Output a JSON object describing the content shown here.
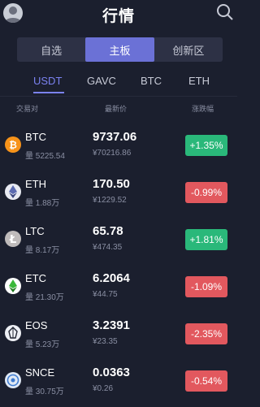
{
  "header": {
    "title": "行情"
  },
  "segments": [
    {
      "label": "自选"
    },
    {
      "label": "主板"
    },
    {
      "label": "创新区"
    }
  ],
  "market_tabs": [
    {
      "label": "USDT"
    },
    {
      "label": "GAVC"
    },
    {
      "label": "BTC"
    },
    {
      "label": "ETH"
    }
  ],
  "columns": {
    "pair": "交易对",
    "price": "最新价",
    "change": "涨跌幅"
  },
  "rows": [
    {
      "symbol": "BTC",
      "volume": "量 5225.54",
      "price": "9737.06",
      "cny": "¥70216.86",
      "change": "+1.35%",
      "direction": "up",
      "icon": "bitcoin-icon"
    },
    {
      "symbol": "ETH",
      "volume": "量 1.88万",
      "price": "170.50",
      "cny": "¥1229.52",
      "change": "-0.99%",
      "direction": "down",
      "icon": "ethereum-icon"
    },
    {
      "symbol": "LTC",
      "volume": "量 8.17万",
      "price": "65.78",
      "cny": "¥474.35",
      "change": "+1.81%",
      "direction": "up",
      "icon": "litecoin-icon"
    },
    {
      "symbol": "ETC",
      "volume": "量 21.30万",
      "price": "6.2064",
      "cny": "¥44.75",
      "change": "-1.09%",
      "direction": "down",
      "icon": "ethereum-classic-icon"
    },
    {
      "symbol": "EOS",
      "volume": "量 5.23万",
      "price": "3.2391",
      "cny": "¥23.35",
      "change": "-2.35%",
      "direction": "down",
      "icon": "eos-icon"
    },
    {
      "symbol": "SNCE",
      "volume": "量 30.75万",
      "price": "0.0363",
      "cny": "¥0.26",
      "change": "-0.54%",
      "direction": "down",
      "icon": "snce-icon"
    }
  ],
  "colors": {
    "up": "#2ab87a",
    "down": "#e2585e",
    "accent": "#6b71d6",
    "background": "#1b1f2e"
  }
}
